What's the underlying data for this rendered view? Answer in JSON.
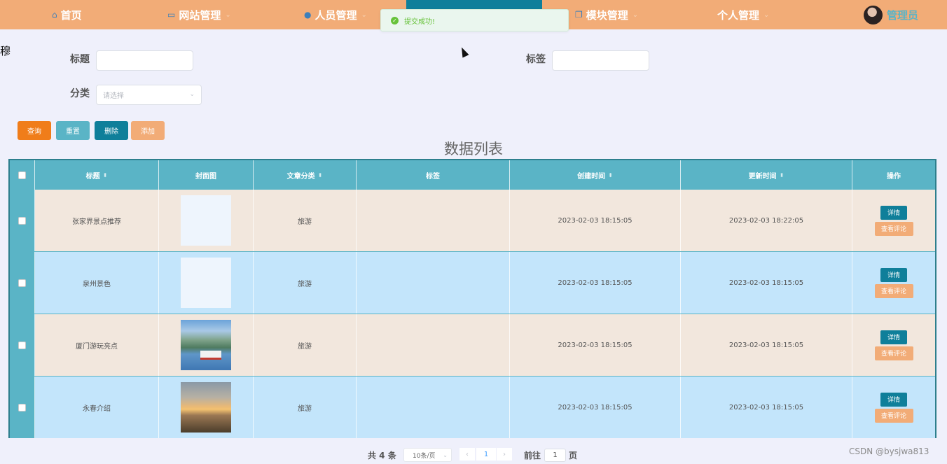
{
  "nav": {
    "items": [
      {
        "label": "首页",
        "icon": "home-icon",
        "has_dropdown": false
      },
      {
        "label": "网站管理",
        "icon": "monitor-icon",
        "has_dropdown": true
      },
      {
        "label": "人员管理",
        "icon": "user-icon",
        "has_dropdown": true
      },
      {
        "label": "模块管理",
        "icon": "copy-icon",
        "has_dropdown": true
      },
      {
        "label": "个人管理",
        "icon": "",
        "has_dropdown": true
      }
    ],
    "admin_name": "管理员"
  },
  "toast": {
    "text": "提交成功!",
    "type": "success"
  },
  "edge_text": "穆",
  "search": {
    "title_label": "标题",
    "tag_label": "标签",
    "category_label": "分类",
    "category_placeholder": "请选择"
  },
  "buttons": {
    "query": "查询",
    "reset": "重置",
    "delete": "删除",
    "add": "添加"
  },
  "table": {
    "title": "数据列表",
    "columns": [
      "标题",
      "封面图",
      "文章分类",
      "标签",
      "创建时间",
      "更新时间",
      "操作"
    ],
    "rows": [
      {
        "title": "张家界景点推荐",
        "cover": "blank",
        "category": "旅游",
        "tag": "",
        "created": "2023-02-03 18:15:05",
        "updated": "2023-02-03 18:22:05"
      },
      {
        "title": "泉州景色",
        "cover": "blank",
        "category": "旅游",
        "tag": "",
        "created": "2023-02-03 18:15:05",
        "updated": "2023-02-03 18:15:05"
      },
      {
        "title": "厦门游玩亮点",
        "cover": "lake-boat-photo",
        "category": "旅游",
        "tag": "",
        "created": "2023-02-03 18:15:05",
        "updated": "2023-02-03 18:15:05"
      },
      {
        "title": "永春介绍",
        "cover": "sunset-lake-photo",
        "category": "旅游",
        "tag": "",
        "created": "2023-02-03 18:15:05",
        "updated": "2023-02-03 18:15:05"
      }
    ],
    "op_detail": "详情",
    "op_comment": "查看评论"
  },
  "pagination": {
    "total": "共 4 条",
    "page_size": "10条/页",
    "current_page": "1",
    "goto_label": "前往",
    "goto_value": "1",
    "page_unit": "页"
  },
  "watermark": "CSDN @bysjwa813",
  "colors": {
    "nav_bg": "#f2ac77",
    "accent": "#0f7f9a",
    "header_bg": "#5ab4c6",
    "row_odd": "#f2e7dd",
    "row_even": "#c3e5fb",
    "query_btn": "#f07d1a",
    "reset_btn": "#5ab4c6",
    "success": "#67c23a"
  }
}
